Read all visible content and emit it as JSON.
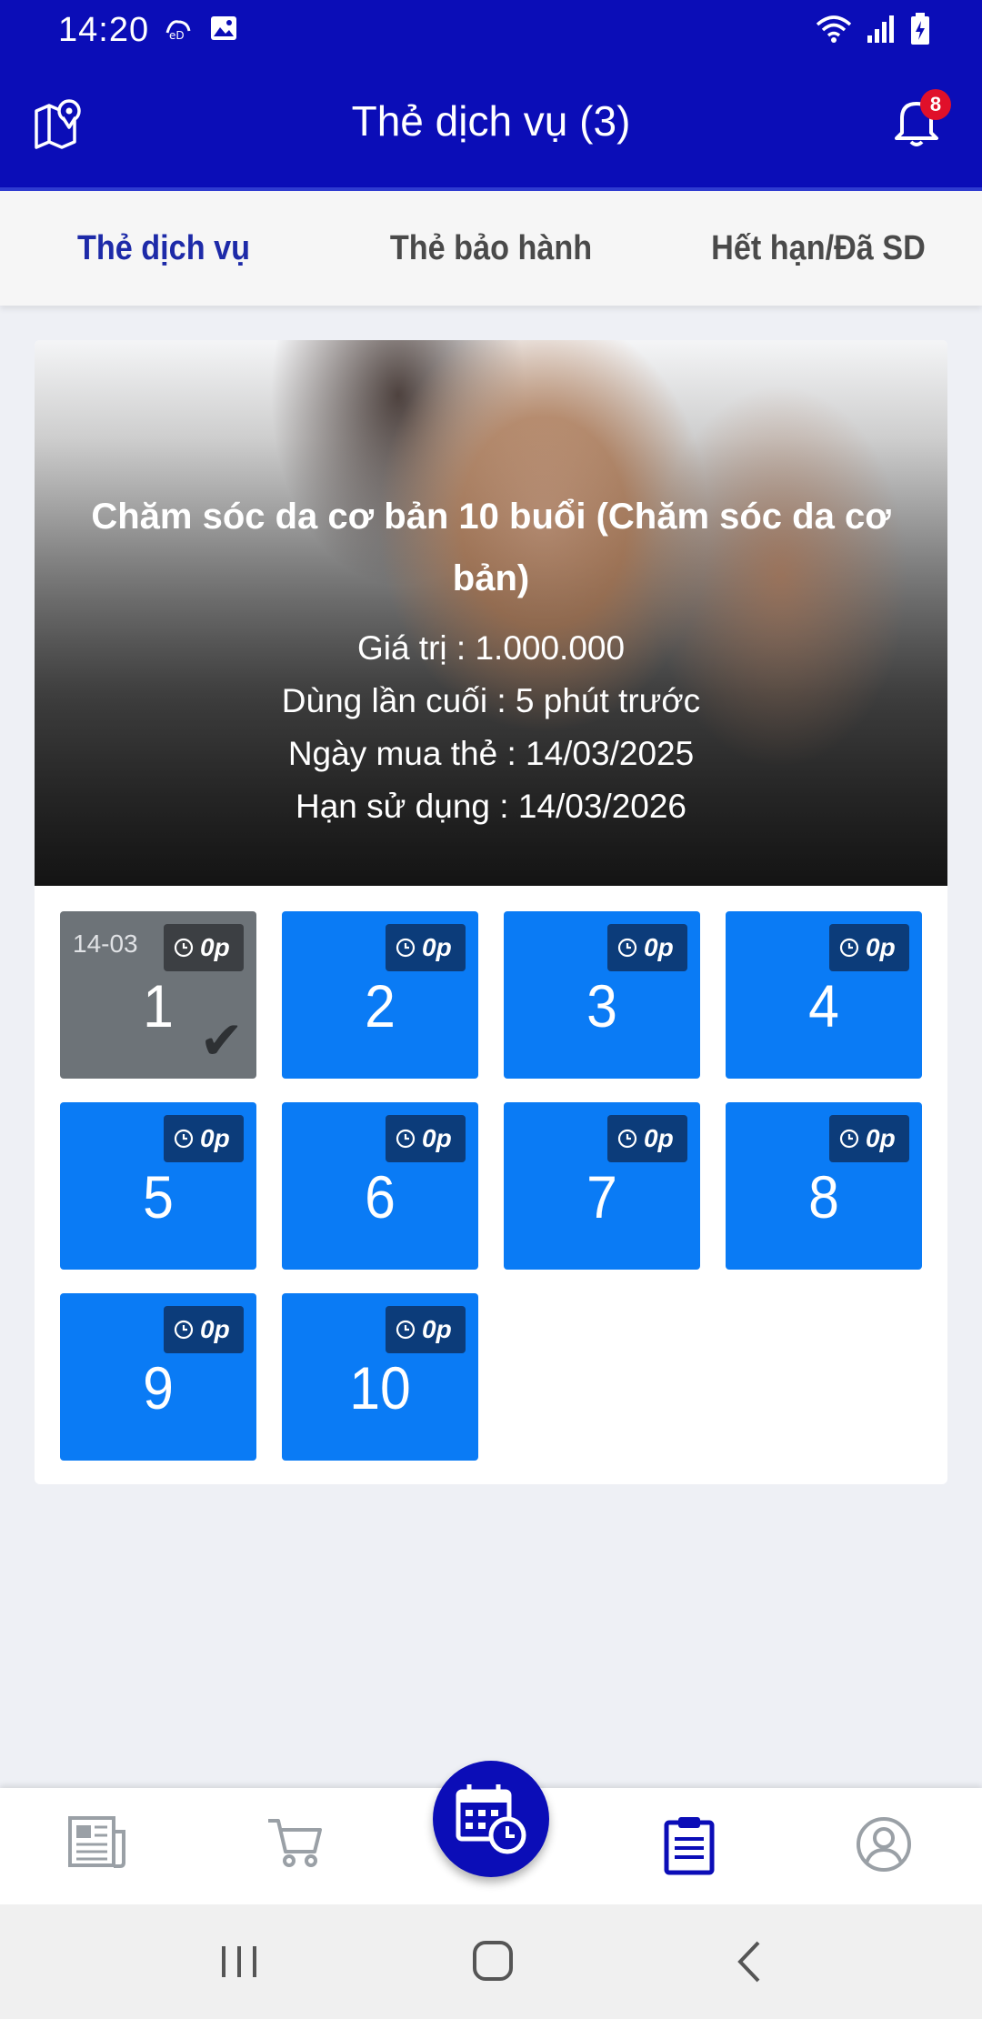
{
  "status_bar": {
    "time": "14:20",
    "left_icons": [
      "notification-app-icon",
      "image-icon"
    ],
    "right_icons": [
      "wifi-icon",
      "signal-icon",
      "battery-icon"
    ]
  },
  "header": {
    "title": "Thẻ dịch vụ (3)",
    "notification_count": "8",
    "color": "#0b0db7"
  },
  "tabs": [
    {
      "label": "Thẻ dịch vụ",
      "active": true
    },
    {
      "label": "Thẻ bảo hành",
      "active": false
    },
    {
      "label": "Hết hạn/Đã SD",
      "active": false
    }
  ],
  "card": {
    "title": "Chăm sóc da cơ bản 10 buổi (Chăm sóc da cơ bản)",
    "value_line": "Giá trị : 1.000.000",
    "last_used_line": "Dùng lần cuối : 5 phút trước",
    "purchase_date_line": "Ngày mua thẻ : 14/03/2025",
    "expiry_line": "Hạn sử dụng : 14/03/2026"
  },
  "sessions": [
    {
      "number": "1",
      "duration": "0p",
      "date": "14-03",
      "used": true
    },
    {
      "number": "2",
      "duration": "0p",
      "date": "",
      "used": false
    },
    {
      "number": "3",
      "duration": "0p",
      "date": "",
      "used": false
    },
    {
      "number": "4",
      "duration": "0p",
      "date": "",
      "used": false
    },
    {
      "number": "5",
      "duration": "0p",
      "date": "",
      "used": false
    },
    {
      "number": "6",
      "duration": "0p",
      "date": "",
      "used": false
    },
    {
      "number": "7",
      "duration": "0p",
      "date": "",
      "used": false
    },
    {
      "number": "8",
      "duration": "0p",
      "date": "",
      "used": false
    },
    {
      "number": "9",
      "duration": "0p",
      "date": "",
      "used": false
    },
    {
      "number": "10",
      "duration": "0p",
      "date": "",
      "used": false
    }
  ],
  "colors": {
    "session_active": "#0a7bf5",
    "session_used": "#6d7378",
    "active_tab": "#1d2aa8"
  },
  "bottom_nav": [
    "news-icon",
    "cart-icon",
    "booking-calendar-icon",
    "clipboard-icon",
    "user-profile-icon"
  ]
}
